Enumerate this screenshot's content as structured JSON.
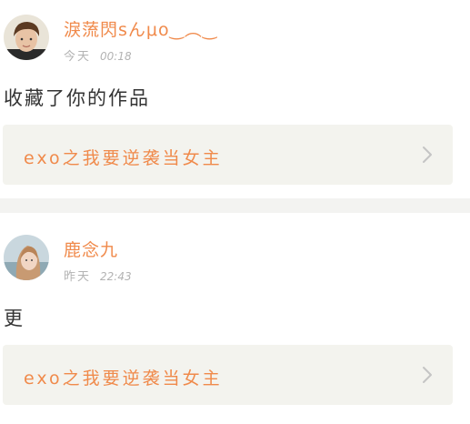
{
  "posts": [
    {
      "username": "淚蓅閃sんμo‿︵‿",
      "date_label": "今天",
      "time": "00:18",
      "text": "收藏了你的作品",
      "work_title": "exo之我要逆袭当女主",
      "icons": {
        "avatar": "user-avatar",
        "chevron": "chevron-right-icon"
      }
    },
    {
      "username": "鹿念九",
      "date_label": "昨天",
      "time": "22:43",
      "text": "更",
      "work_title": "exo之我要逆袭当女主",
      "icons": {
        "avatar": "user-avatar",
        "chevron": "chevron-right-icon"
      }
    }
  ],
  "colors": {
    "accent": "#f08a4b",
    "card_bg": "#f3f3ee",
    "meta_gray": "#b3b3b3",
    "body_text": "#333333",
    "separator": "#f3f3f1"
  }
}
